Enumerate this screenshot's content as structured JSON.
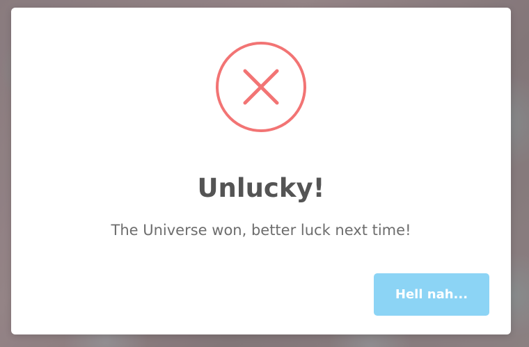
{
  "dialog": {
    "title": "Unlucky!",
    "message": "The Universe won, better luck next time!",
    "confirm_label": "Hell nah...",
    "icon": "error-x-icon"
  },
  "colors": {
    "error_red": "#f27474",
    "button_bg": "#8cd4f5",
    "title_text": "#545454",
    "message_text": "#6d6d6d"
  }
}
